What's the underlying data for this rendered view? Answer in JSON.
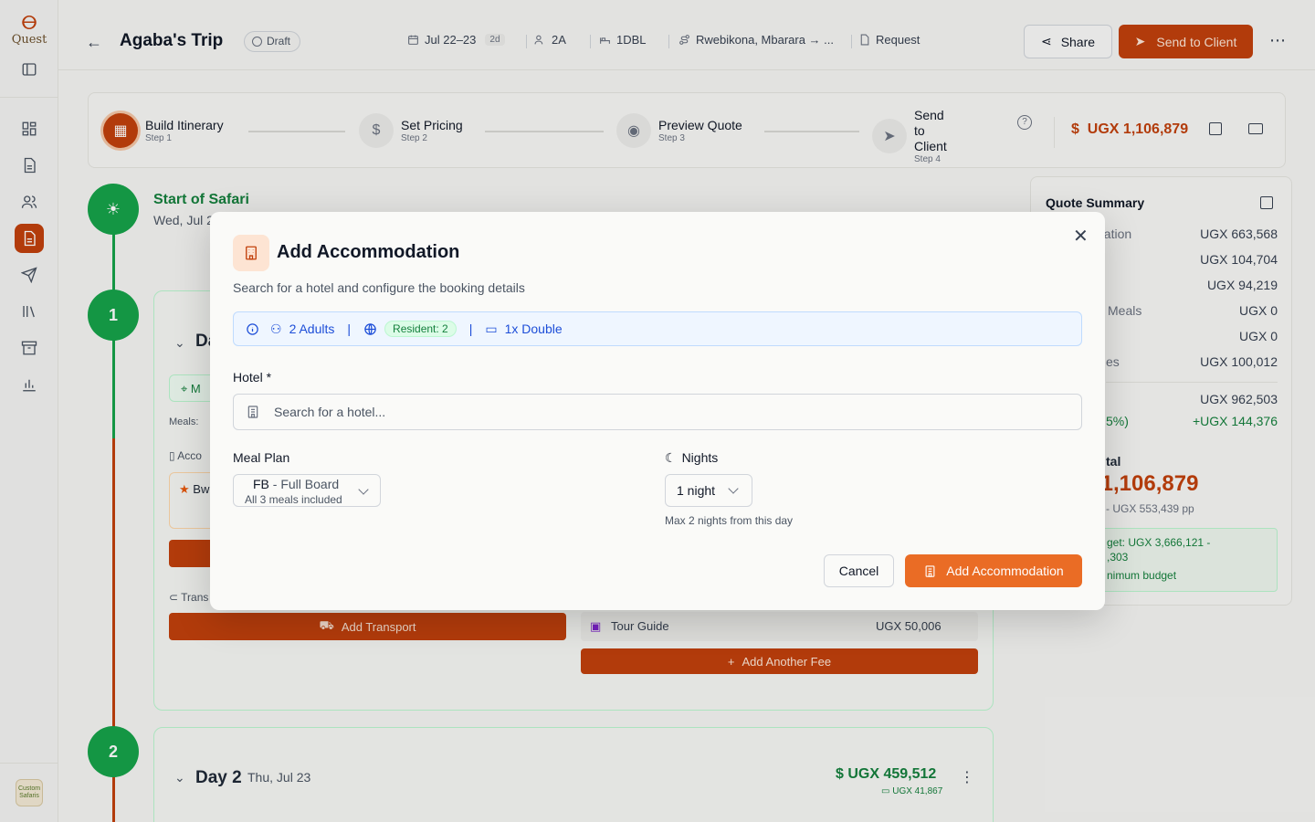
{
  "app": {
    "logo_text": "Quest",
    "avatar_text": "Custom Safaris"
  },
  "header": {
    "title": "Agaba's Trip",
    "status": "Draft",
    "dates": "Jul 22–23",
    "duration": "2d",
    "pax": "2A",
    "rooms": "1DBL",
    "route": "Rwebikona, Mbarara → ...",
    "type": "Request",
    "share_label": "Share",
    "send_label": "Send to Client"
  },
  "stepper": {
    "steps": [
      {
        "label": "Build Itinerary",
        "sub": "Step 1"
      },
      {
        "label": "Set Pricing",
        "sub": "Step 2"
      },
      {
        "label": "Preview Quote",
        "sub": "Step 3"
      },
      {
        "label": "Send to Client",
        "sub": "Step 4"
      }
    ],
    "total": "UGX 1,106,879"
  },
  "timeline": {
    "start_title": "Start of Safari",
    "start_date": "Wed, Jul 2",
    "day1_num": "1",
    "day1_partial": "Da",
    "meals_label": "Meals:",
    "acco_partial": "Acco",
    "hotel_partial": "Bw",
    "trans_partial": "Trans",
    "add_transport": "Add Transport",
    "fee_name": "Tour Guide",
    "fee_value": "UGX 50,006",
    "add_fee": "Add Another Fee",
    "day2_num": "2",
    "day2_title": "Day 2",
    "day2_date": "Thu, Jul 23",
    "day2_total": "UGX 459,512",
    "day2_sub": "UGX 41,867"
  },
  "quote": {
    "title": "Quote Summary",
    "rows": [
      {
        "label": "dation",
        "value": "UGX 663,568"
      },
      {
        "label": "",
        "value": "UGX 104,704"
      },
      {
        "label": "",
        "value": "UGX 94,219"
      },
      {
        "label": "Meals",
        "value": "UGX 0"
      },
      {
        "label": "",
        "value": "UGX 0"
      },
      {
        "label": "es",
        "value": "UGX 100,012"
      },
      {
        "label": "",
        "value": "UGX 962,503"
      },
      {
        "label": "5%)",
        "value": "+UGX 144,376"
      }
    ],
    "total_label": "tal",
    "total_value": ",1,106,879",
    "per_person": "- UGX 553,439 pp",
    "budget_line1": "get: UGX 3,666,121 -",
    "budget_line2": ",303",
    "budget_line3": "nimum budget"
  },
  "modal": {
    "title": "Add Accommodation",
    "subtitle": "Search for a hotel and configure the booking details",
    "adults": "2 Adults",
    "resident": "Resident: 2",
    "room": "1x Double",
    "hotel_label": "Hotel *",
    "hotel_placeholder": "Search for a hotel...",
    "meal_label": "Meal Plan",
    "meal_code": "FB",
    "meal_name": " - Full Board",
    "meal_desc": "All 3 meals included",
    "nights_label": "Nights",
    "nights_value": "1 night",
    "nights_hint": "Max 2 nights from this day",
    "cancel": "Cancel",
    "submit": "Add Accommodation"
  },
  "colors": {
    "accent": "#c2410c",
    "success": "#16a34a",
    "info": "#1d4ed8"
  }
}
